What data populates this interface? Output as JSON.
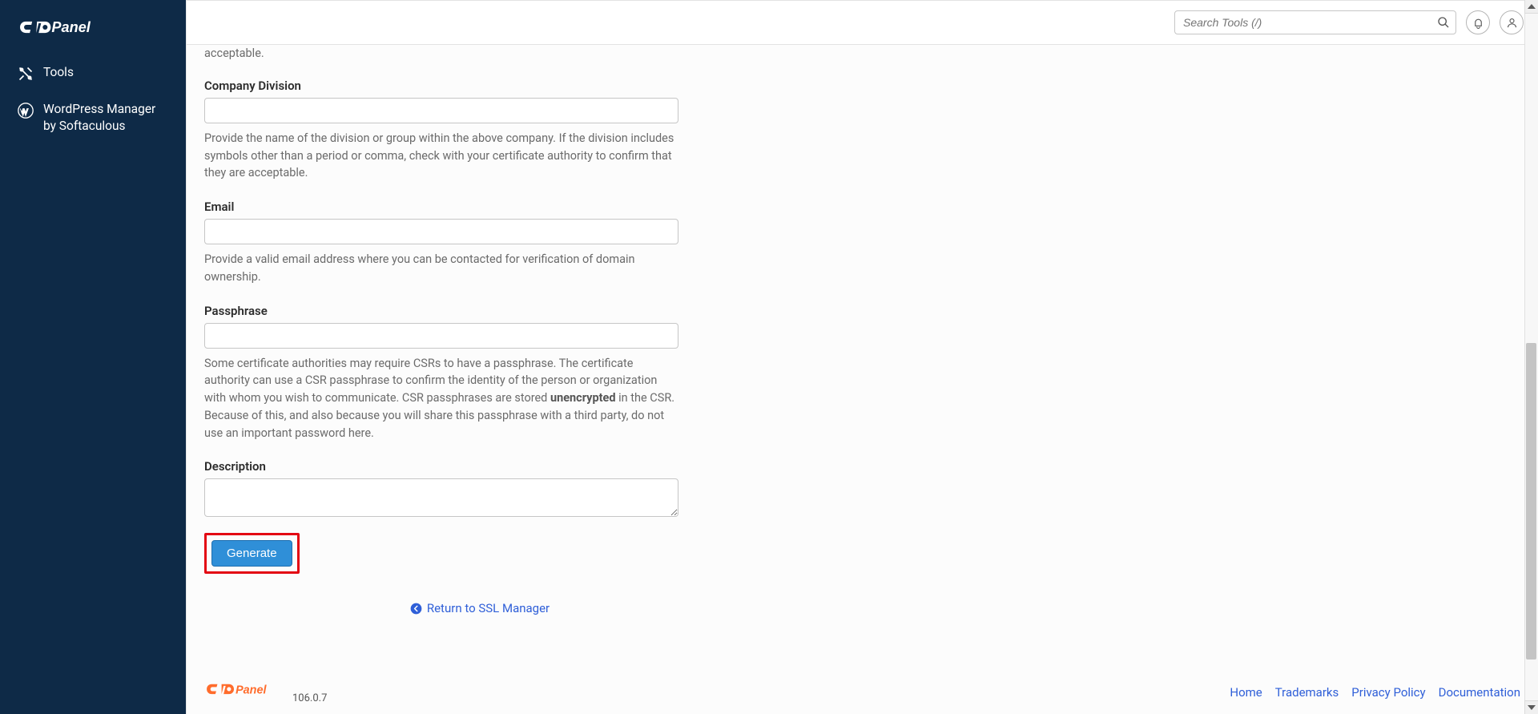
{
  "sidebar": {
    "items": [
      {
        "label": "Tools"
      },
      {
        "label": "WordPress Manager by Softaculous"
      }
    ]
  },
  "topbar": {
    "search_placeholder": "Search Tools (/)"
  },
  "form": {
    "intro_tail": "acceptable.",
    "company_division": {
      "label": "Company Division",
      "value": "",
      "help": "Provide the name of the division or group within the above company. If the division includes symbols other than a period or comma, check with your certificate authority to confirm that they are acceptable."
    },
    "email": {
      "label": "Email",
      "value": "",
      "help": "Provide a valid email address where you can be contacted for verification of domain ownership."
    },
    "passphrase": {
      "label": "Passphrase",
      "value": "",
      "help_pre": "Some certificate authorities may require CSRs to have a passphrase. The certificate authority can use a CSR passphrase to confirm the identity of the person or organization with whom you wish to communicate. CSR passphrases are stored ",
      "help_strong": "unencrypted",
      "help_post": " in the CSR. Because of this, and also because you will share this passphrase with a third party, do not use an important password here."
    },
    "description": {
      "label": "Description",
      "value": ""
    },
    "generate_label": "Generate",
    "return_label": "Return to SSL Manager"
  },
  "footer": {
    "version": "106.0.7",
    "links": {
      "home": "Home",
      "trademarks": "Trademarks",
      "privacy": "Privacy Policy",
      "docs": "Documentation"
    }
  }
}
